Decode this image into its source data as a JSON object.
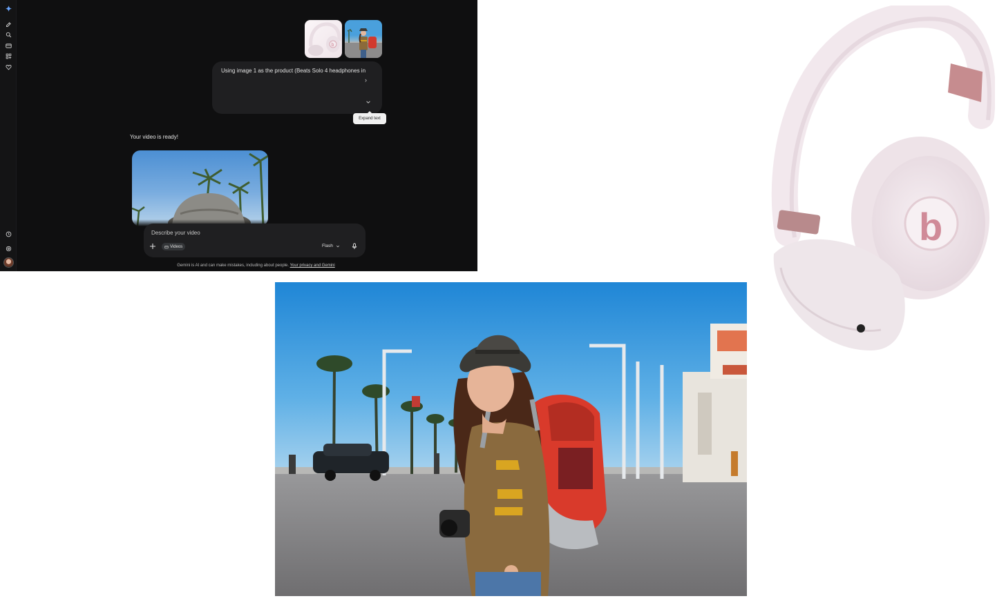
{
  "gemini": {
    "rail_icons": [
      "gemini-sparkle-icon",
      "new-chat-icon",
      "search-icon",
      "videos-icon",
      "apps-icon",
      "gems-icon",
      "activity-icon",
      "settings-icon"
    ],
    "attachments": [
      "headphones-image",
      "traveler-image"
    ],
    "prompt_text": "Using image 1 as the product (Beats Solo 4 headphones in",
    "expand_tooltip": "Expand text",
    "response_text": "Your video is ready!",
    "composer": {
      "placeholder": "Describe your video",
      "tool_chip": "Videos",
      "model": "Flash"
    },
    "disclaimer": "Gemini is AI and can make mistakes, including about people.",
    "privacy_link": "Your privacy and Gemini"
  },
  "colors": {
    "app_background": "#0f0f10",
    "bubble": "#1f1f21",
    "accent_sparkle": "#4b8df8"
  }
}
